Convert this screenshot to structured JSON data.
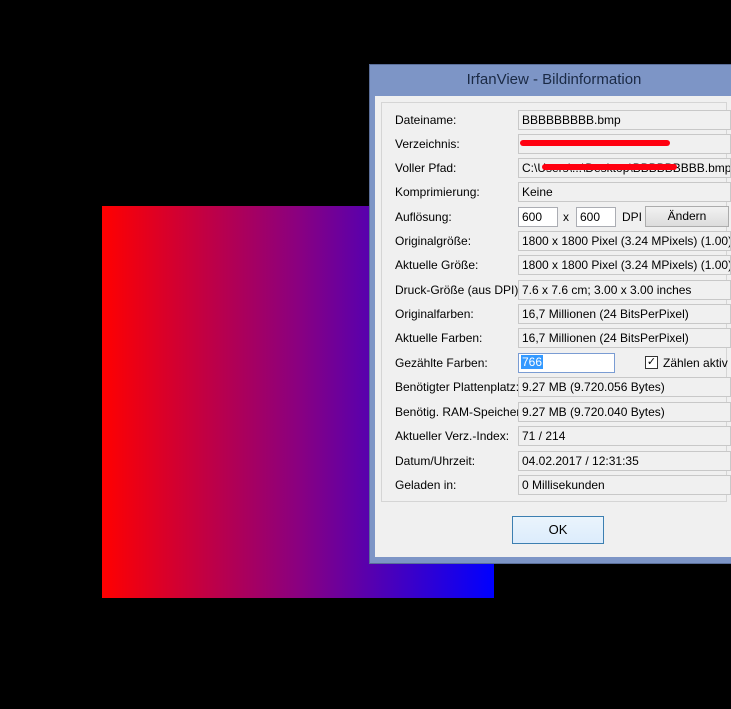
{
  "window": {
    "title": "IrfanView - Bildinformation"
  },
  "rows": [
    {
      "label": "Dateiname:",
      "value": "BBBBBBBBB.bmp"
    },
    {
      "label": "Verzeichnis:",
      "value": ""
    },
    {
      "label": "Voller Pfad:",
      "value": "C:\\Users\\...\\Desktop\\BBBBBBBBB.bmp"
    },
    {
      "label": "Komprimierung:",
      "value": "Keine"
    },
    {
      "label": "Auflösung:",
      "res_x": "600",
      "sep": "x",
      "res_y": "600",
      "unit": "DPI",
      "button": "Ändern"
    },
    {
      "label": "Originalgröße:",
      "value": "1800 x 1800  Pixel (3.24 MPixels) (1.00)"
    },
    {
      "label": "Aktuelle Größe:",
      "value": "1800 x 1800  Pixel (3.24 MPixels) (1.00)"
    },
    {
      "label": "Druck-Größe (aus DPI):",
      "value": "7.6 x 7.6 cm; 3.00 x 3.00 inches"
    },
    {
      "label": "Originalfarben:",
      "value": "16,7 Millionen   (24 BitsPerPixel)"
    },
    {
      "label": "Aktuelle Farben:",
      "value": "16,7 Millionen   (24 BitsPerPixel)"
    },
    {
      "label": "Gezählte Farben:",
      "value": "766",
      "checkbox_label": "Zählen aktiv"
    },
    {
      "label": "Benötigter Plattenplatz:",
      "value": "9.27 MB (9.720.056 Bytes)"
    },
    {
      "label": "Benötig. RAM-Speicher:",
      "value": "9.27  MB (9.720.040 Bytes)"
    },
    {
      "label": "Aktueller Verz.-Index:",
      "value": "71  /  214"
    },
    {
      "label": "Datum/Uhrzeit:",
      "value": "04.02.2017 / 12:31:35"
    },
    {
      "label": "Geladen in:",
      "value": "0 Millisekunden"
    }
  ],
  "ok_label": "OK",
  "colors": {
    "titlebar": "#7d95c6",
    "selection": "#3399ff",
    "redaction": "#ff0010"
  }
}
